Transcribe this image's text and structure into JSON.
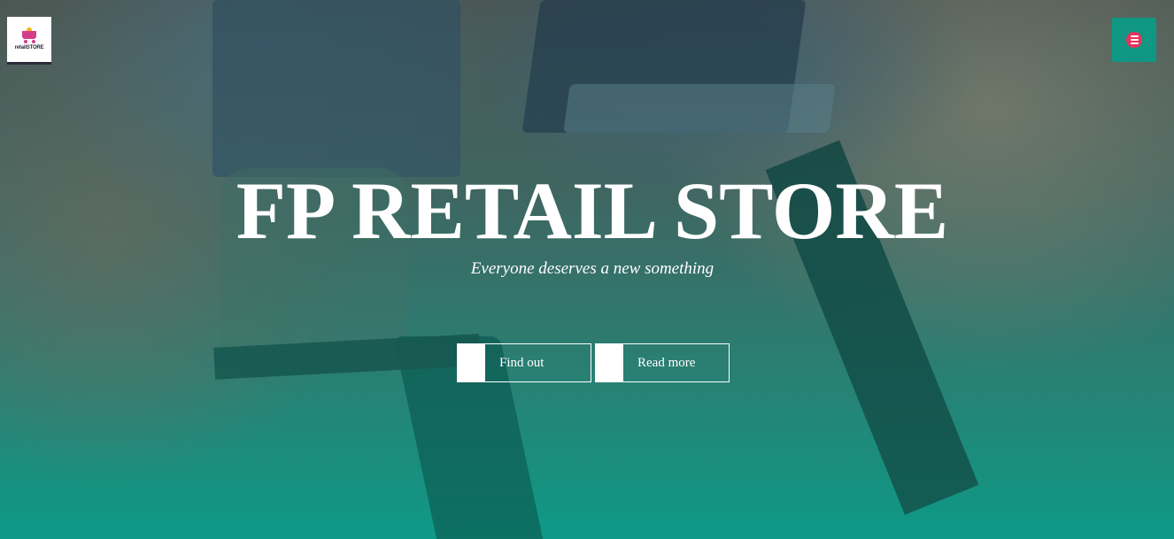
{
  "header": {
    "logo_text": "retailSTORE",
    "logo_icon": "shopping-cart-icon",
    "menu_icon": "hamburger-menu-icon"
  },
  "hero": {
    "title": "FP RETAIL STORE",
    "tagline": "Everyone deserves a new something",
    "buttons": [
      {
        "label": "Find out"
      },
      {
        "label": "Read more"
      }
    ]
  },
  "colors": {
    "menu_button": "#0f9784",
    "menu_icon_bg": "#e8345c",
    "logo_accent": "#d63c8c",
    "hero_gradient_bottom": "#109a88"
  }
}
